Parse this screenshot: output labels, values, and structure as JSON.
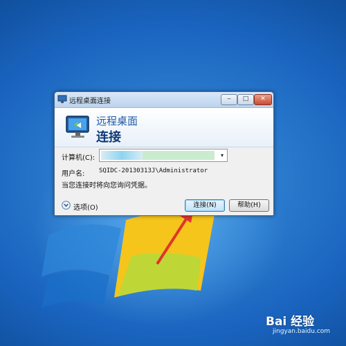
{
  "window": {
    "title": "远程桌面连接",
    "minimize": "‒",
    "maximize": "□",
    "close": "✕"
  },
  "banner": {
    "line1": "远程桌面",
    "line2": "连接"
  },
  "form": {
    "computer_label": "计算机(C):",
    "computer_value": "",
    "username_label": "用户名:",
    "username_value": "SQIDC-20130313J\\Administrator",
    "hint": "当您连接时将向您询问凭据。",
    "dropdown_arrow": "▾"
  },
  "footer": {
    "options_label": "选项(O)",
    "connect_label": "连接(N)",
    "help_label": "帮助(H)"
  },
  "watermark": {
    "logo": "Bai 经验",
    "url": "jingyan.baidu.com"
  },
  "colors": {
    "desktop": "#1f6fc4",
    "arrow": "#e0352b",
    "banner_title": "#1e5aa8"
  }
}
